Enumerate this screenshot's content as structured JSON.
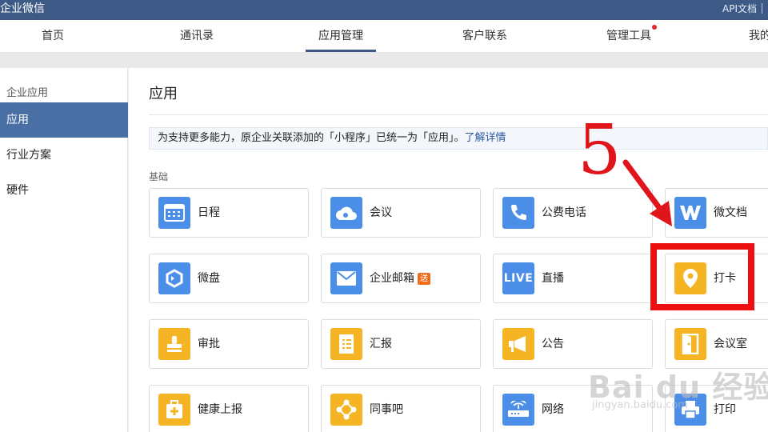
{
  "topbar": {
    "brand": "企业微信",
    "api_doc": "API文档"
  },
  "nav": {
    "items": [
      {
        "label": "首页"
      },
      {
        "label": "通讯录"
      },
      {
        "label": "应用管理"
      },
      {
        "label": "客户联系"
      },
      {
        "label": "管理工具"
      },
      {
        "label": "我的"
      }
    ],
    "active_index": 2
  },
  "sidebar": {
    "heading": "企业应用",
    "items": [
      {
        "label": "应用"
      },
      {
        "label": "行业方案"
      },
      {
        "label": "硬件"
      }
    ],
    "active_index": 0
  },
  "main": {
    "title": "应用",
    "notice_text": "为支持更多能力，原企业关联添加的「小程序」已统一为「应用」。",
    "notice_link": "了解详情",
    "section_label": "基础",
    "apps": [
      {
        "label": "日程",
        "icon": "calendar-icon",
        "color": "#4a8ee8"
      },
      {
        "label": "会议",
        "icon": "cloud-meeting-icon",
        "color": "#4a8ee8"
      },
      {
        "label": "公费电话",
        "icon": "phone-icon",
        "color": "#4a8ee8"
      },
      {
        "label": "微文档",
        "icon": "doc-w-icon",
        "color": "#4a8ee8"
      },
      {
        "label": "微盘",
        "icon": "disk-icon",
        "color": "#4a8ee8"
      },
      {
        "label": "企业邮箱",
        "badge": "送",
        "icon": "mail-icon",
        "color": "#4a8ee8"
      },
      {
        "label": "直播",
        "icon": "live-icon",
        "icon_text": "LIVE",
        "color": "#4a8ee8"
      },
      {
        "label": "打卡",
        "icon": "location-pin-icon",
        "color": "#f4b424"
      },
      {
        "label": "审批",
        "icon": "stamp-icon",
        "color": "#f4b424"
      },
      {
        "label": "汇报",
        "icon": "report-icon",
        "color": "#f4b424"
      },
      {
        "label": "公告",
        "icon": "megaphone-icon",
        "color": "#f4b424"
      },
      {
        "label": "会议室",
        "icon": "door-icon",
        "color": "#f4b424"
      },
      {
        "label": "健康上报",
        "icon": "health-kit-icon",
        "color": "#f4b424"
      },
      {
        "label": "同事吧",
        "icon": "network-icon",
        "color": "#f4b424"
      },
      {
        "label": "网络",
        "icon": "router-icon",
        "color": "#4a8ee8"
      },
      {
        "label": "打印",
        "icon": "printer-icon",
        "color": "#4a8ee8"
      }
    ]
  },
  "annotation": {
    "step_number": "5"
  },
  "watermark": {
    "text": "Bai du 经验",
    "url": "jingyan.baidu.com"
  }
}
